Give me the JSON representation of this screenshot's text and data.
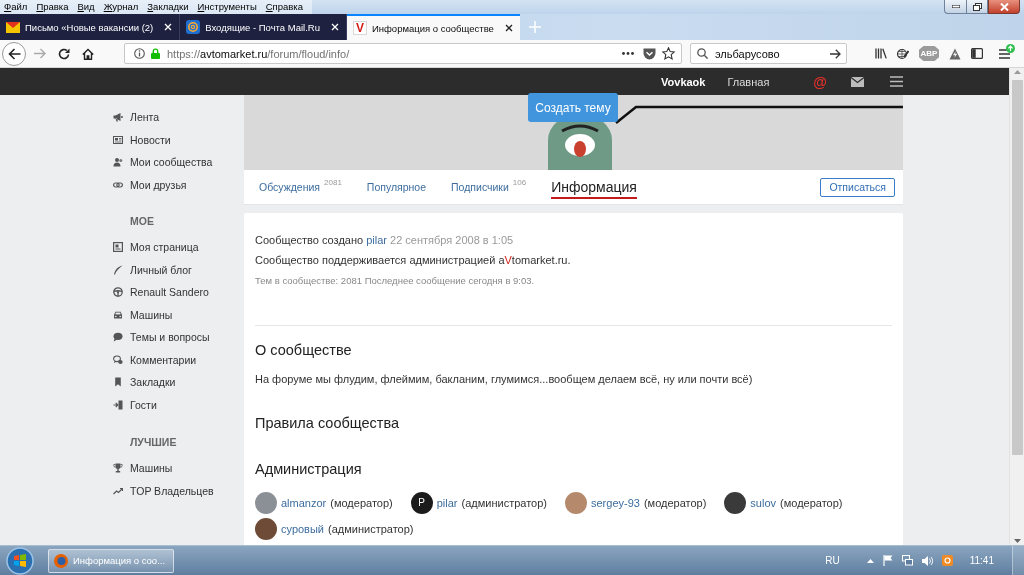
{
  "menu_bar": {
    "items": [
      "Файл",
      "Правка",
      "Вид",
      "Журнал",
      "Закладки",
      "Инструменты",
      "Справка"
    ]
  },
  "browser_tabs": [
    {
      "title": "Письмо «Новые вакансии (2)",
      "selected": false
    },
    {
      "title": "Входящие - Почта Mail.Ru",
      "selected": false
    },
    {
      "title": "Информация о сообществе",
      "icon_text": "V",
      "selected": true
    }
  ],
  "toolbar": {
    "url": "https://**avtomarket.ru**/forum/floud/info/",
    "search": {
      "value": "эльбарусово"
    },
    "adblock_label": "ABP"
  },
  "site_header": {
    "user": "Vovkaok",
    "home_link": "Главная",
    "mention_symbol": "@"
  },
  "sidebar": {
    "items": [
      "Лента",
      "Новости",
      "Мои сообщества",
      "Мои друзья"
    ],
    "sections": [
      {
        "title": "МОЕ",
        "items": [
          "Моя страница",
          "Личный блог",
          "Renault Sandero",
          "Машины",
          "Темы и вопросы",
          "Комментарии",
          "Закладки",
          "Гости"
        ]
      },
      {
        "title": "ЛУЧШИЕ",
        "items": [
          "Машины",
          "TOP Владельцев"
        ]
      }
    ]
  },
  "create_button": "Создать тему",
  "community_tabs": [
    {
      "label": "Обсуждения",
      "count": "2081",
      "selected": false
    },
    {
      "label": "Популярное",
      "selected": false
    },
    {
      "label": "Подписчики",
      "count": "106",
      "selected": false
    },
    {
      "label": "Информация",
      "selected": true
    }
  ],
  "unsubscribe_button": "Отписаться",
  "info": {
    "created_label": "Сообщество создано",
    "author": "pilar",
    "created_date": "22 сентября 2008 в 1:05",
    "support_text": "Сообщество поддерживается администрацией a**V**tomarket.ru.",
    "stats_text": "Тем в сообществе: 2081 Последнее сообщение сегодня в 9:03."
  },
  "about": {
    "title": "О сообществе",
    "text": "На форуме мы флудим, флеймим, бакланим, глумимся...вообщем делаем всё, ну или почти всё)"
  },
  "rules": {
    "title": "Правила сообщества"
  },
  "administration": {
    "title": "Администрация",
    "members": [
      {
        "name": "almanzor",
        "role": "(модератор)"
      },
      {
        "name": "pilar",
        "role": "(администратор)",
        "avatar_text": "P"
      },
      {
        "name": "sergey-93",
        "role": "(модератор)"
      },
      {
        "name": "sulov",
        "role": "(модератор)"
      },
      {
        "name": "суровый",
        "role": "(администратор)"
      }
    ]
  },
  "taskbar": {
    "task": "Информация о соо...",
    "language": "RU",
    "clock": "11:41"
  }
}
